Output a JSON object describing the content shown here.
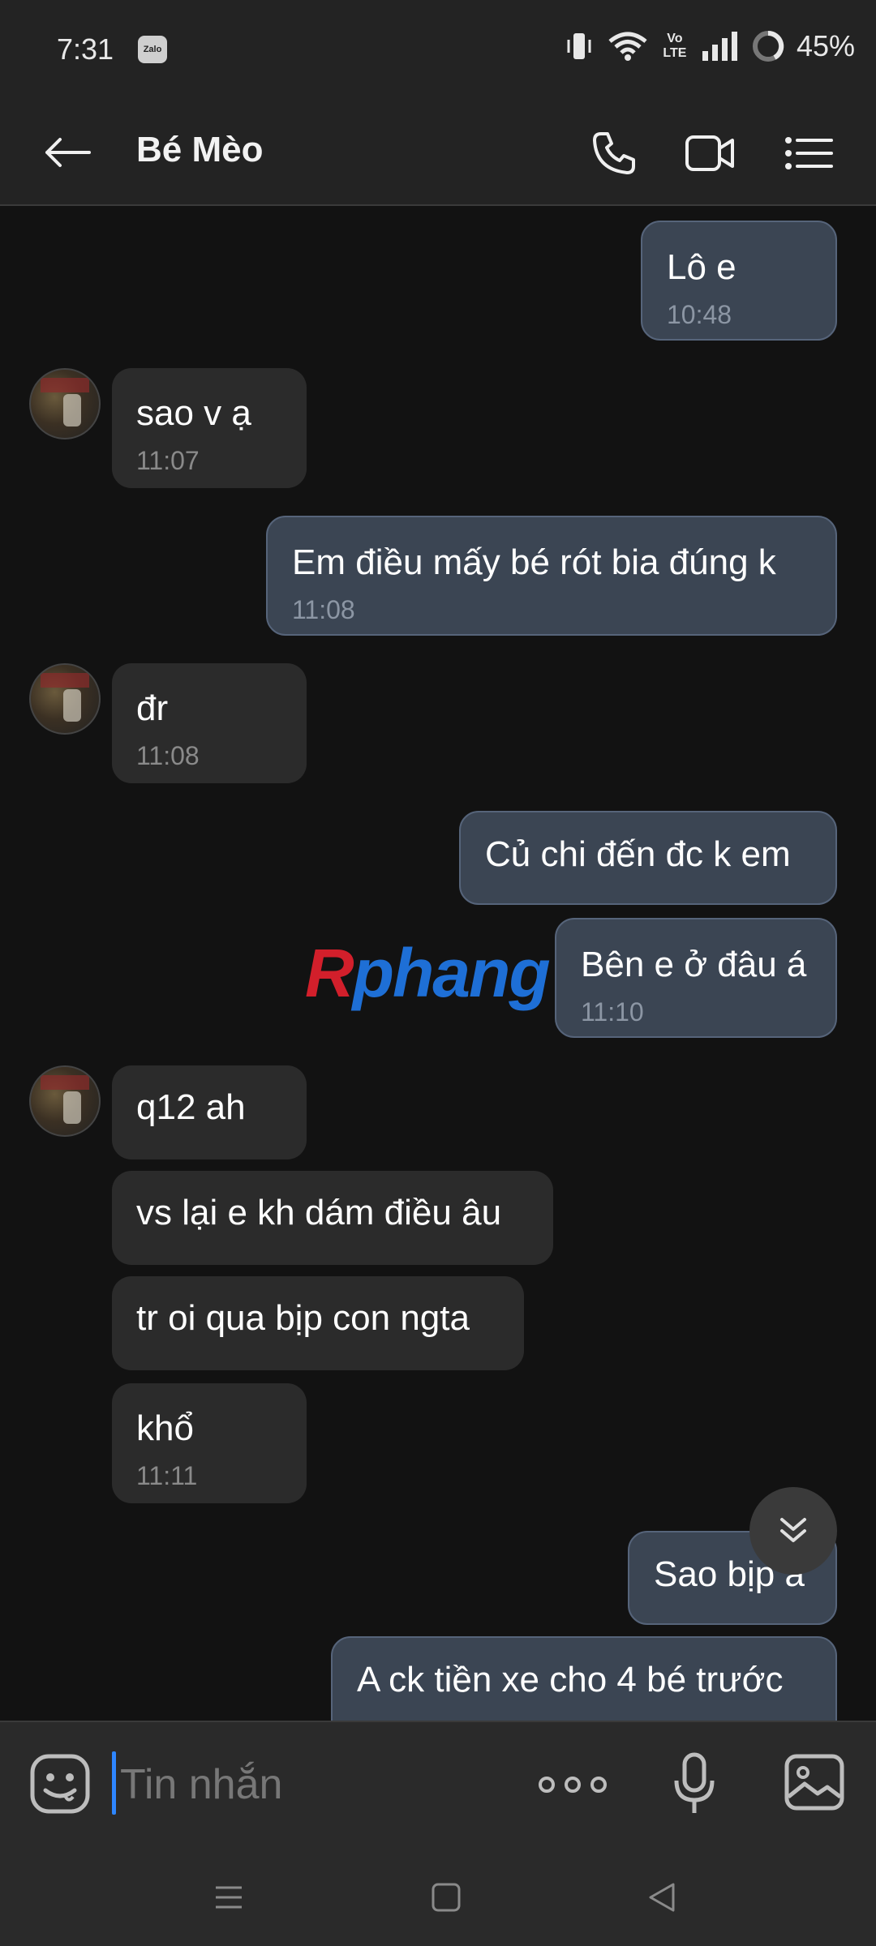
{
  "status_bar": {
    "time": "7:31",
    "zalo_label": "Zalo",
    "network": "Vo LTE",
    "battery": "45%"
  },
  "header": {
    "title": "Bé Mèo"
  },
  "messages": [
    {
      "dir": "out",
      "text": "Lô e",
      "time": "10:48"
    },
    {
      "dir": "in",
      "text": "sao v ạ",
      "time": "11:07"
    },
    {
      "dir": "out",
      "text": "Em điều mấy bé rót bia đúng k",
      "time": "11:08"
    },
    {
      "dir": "in",
      "text": "đr",
      "time": "11:08"
    },
    {
      "dir": "out",
      "text": "Củ chi đến đc k em",
      "time": ""
    },
    {
      "dir": "out",
      "text": "Bên e ở đâu á",
      "time": "11:10"
    },
    {
      "dir": "in",
      "text": "q12 ah",
      "time": ""
    },
    {
      "dir": "in",
      "text": "vs lại e kh dám điều âu",
      "time": ""
    },
    {
      "dir": "in",
      "text": "tr oi qua bịp con ngta",
      "time": ""
    },
    {
      "dir": "in",
      "text": "khổ",
      "time": "11:11"
    },
    {
      "dir": "out",
      "text": "Sao bịp a",
      "time": ""
    },
    {
      "dir": "out",
      "text": "A ck tiền xe cho 4 bé trước",
      "time": ""
    }
  ],
  "watermark": {
    "part1": "R",
    "part2": "phang"
  },
  "input": {
    "placeholder": "Tin nhắn",
    "value": ""
  },
  "colors": {
    "outgoing_bubble": "#3b4553",
    "incoming_bubble": "#2b2b2b",
    "accent_cursor": "#2e86ff",
    "background": "#121212"
  }
}
